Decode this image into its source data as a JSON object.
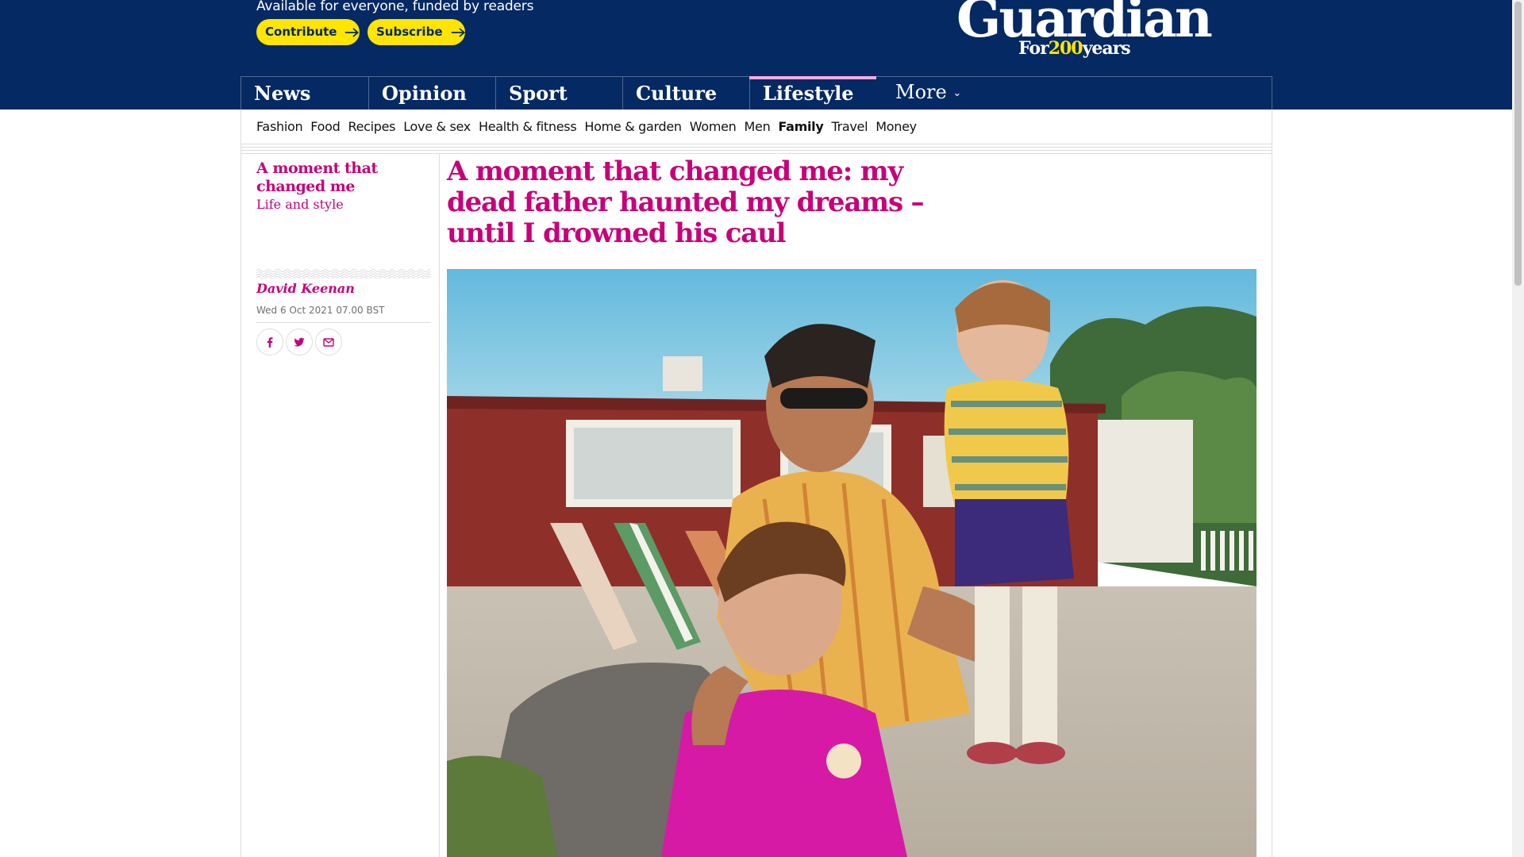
{
  "header": {
    "support_text": "Available for everyone, funded by readers",
    "contribute_label": "Contribute",
    "subscribe_label": "Subscribe",
    "logo_word": "Guardian",
    "logo_for": "For",
    "logo_years_number": "200",
    "logo_years": "years"
  },
  "nav": {
    "pillars": [
      "News",
      "Opinion",
      "Sport",
      "Culture",
      "Lifestyle"
    ],
    "active_pillar": "Lifestyle",
    "more_label": "More"
  },
  "subnav": {
    "items": [
      "Fashion",
      "Food",
      "Recipes",
      "Love & sex",
      "Health & fitness",
      "Home & garden",
      "Women",
      "Men",
      "Family",
      "Travel",
      "Money"
    ],
    "active": "Family"
  },
  "article": {
    "series": "A moment that changed me",
    "section": "Life and style",
    "author": "David Keenan",
    "date": "Wed 6 Oct 2021 07.00 BST",
    "headline": "A moment that changed me: my dead father haunted my dreams – until I drowned his caul",
    "share": [
      "facebook-icon",
      "twitter-icon",
      "email-icon"
    ]
  },
  "colors": {
    "brand_navy": "#052962",
    "lifestyle_accent": "#c70079",
    "lifestyle_highlight": "#ffabdb",
    "cta_yellow": "#ffe500"
  }
}
